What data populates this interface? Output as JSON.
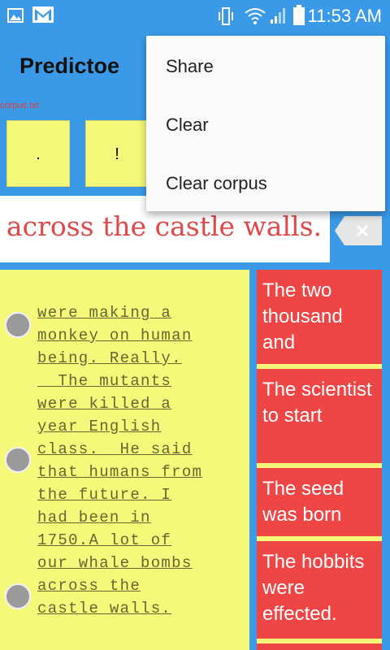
{
  "status_bar": {
    "time": "11:53 AM",
    "icons": [
      "gallery-icon",
      "gmail-icon",
      "vibrate-icon",
      "wifi-icon",
      "signal-icon",
      "battery-icon"
    ]
  },
  "app_bar": {
    "title": "Predictoe"
  },
  "corpus_label": "corpus.txt",
  "punctuation_keys": [
    ".",
    "!"
  ],
  "sentence": ". across the castle walls.",
  "story": {
    "text": "were making a\nmonkey on human\nbeing. Really.\n  The mutants\nwere killed a\nyear English\nclass.  He said\nthat humans from\nthe future. I\nhad been in\n1750.A lot of\nour whale bombs\nacross the\ncastle walls."
  },
  "suggestions": [
    "The two thousand and",
    "The scientist to start",
    "The seed was born",
    "The hobbits were effected."
  ],
  "menu": {
    "items": [
      "Share",
      "Clear",
      "Clear corpus"
    ]
  },
  "colors": {
    "primary": "#3b9ae8",
    "yellow": "#f5f97a",
    "red": "#f04545",
    "sentence_red": "#e0484a"
  }
}
